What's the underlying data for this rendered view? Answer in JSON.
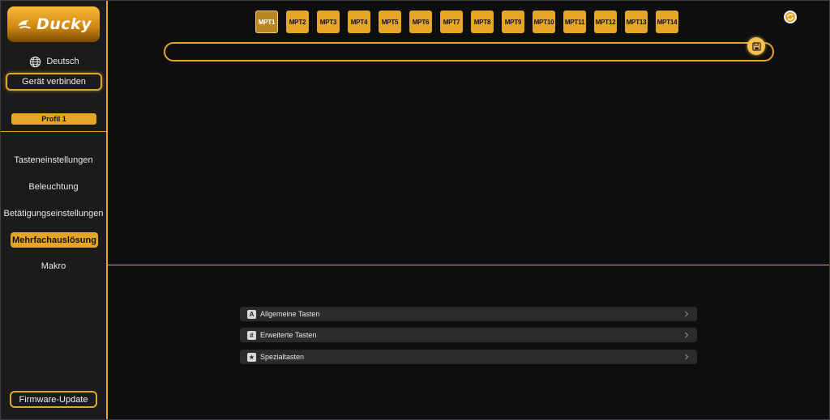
{
  "app": {
    "brand": "Ducky"
  },
  "sidebar": {
    "language_label": "Deutsch",
    "connect_label": "Gerät verbinden",
    "profile_label": "Profil 1",
    "nav": [
      {
        "label": "Tasteneinstellungen",
        "active": false
      },
      {
        "label": "Beleuchtung",
        "active": false
      },
      {
        "label": "Betätigungseinstellungen",
        "active": false
      },
      {
        "label": "Mehrfachauslösung",
        "active": true
      },
      {
        "label": "Makro",
        "active": false
      }
    ],
    "firmware_label": "Firmware-Update"
  },
  "main": {
    "macro_tabs": [
      "MPT1",
      "MPT2",
      "MPT3",
      "MPT4",
      "MPT5",
      "MPT6",
      "MPT7",
      "MPT8",
      "MPT9",
      "MPT10",
      "MPT11",
      "MPT12",
      "MPT13",
      "MPT14"
    ],
    "active_tab": "MPT1",
    "icons": {
      "refresh": "refresh-icon",
      "save": "save-icon"
    }
  },
  "key_categories": [
    {
      "badge": "A",
      "label": "Allgemeine Tasten"
    },
    {
      "badge": "#",
      "label": "Erweiterte Tasten"
    },
    {
      "badge": "★",
      "label": "Spezialtasten"
    }
  ],
  "colors": {
    "accent": "#e5a628",
    "background": "#0e0e0e",
    "sidebar": "#1b1b1b",
    "row": "#2b2b2b"
  }
}
